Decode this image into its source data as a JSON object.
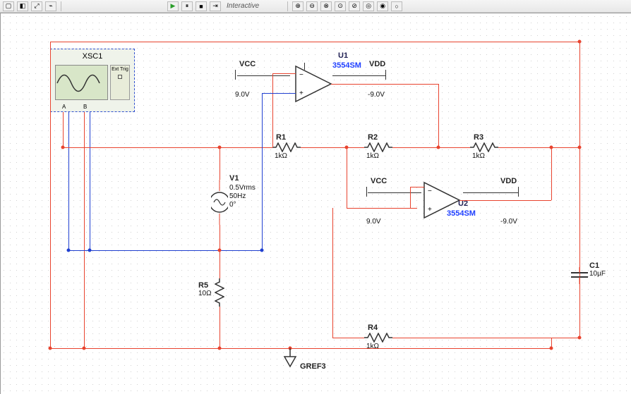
{
  "toolbar": {
    "mode_label": "Interactive"
  },
  "scope": {
    "ref": "XSC1",
    "ext_label": "Ext Trig",
    "chA": "A",
    "chB": "B"
  },
  "components": {
    "U1": {
      "ref": "U1",
      "model": "3554SM",
      "vcc_label": "VCC",
      "vdd_label": "VDD",
      "vcc": "9.0V",
      "vdd": "-9.0V"
    },
    "U2": {
      "ref": "U2",
      "model": "3554SM",
      "vcc_label": "VCC",
      "vdd_label": "VDD",
      "vcc": "9.0V",
      "vdd": "-9.0V"
    },
    "R1": {
      "ref": "R1",
      "value": "1kΩ"
    },
    "R2": {
      "ref": "R2",
      "value": "1kΩ"
    },
    "R3": {
      "ref": "R3",
      "value": "1kΩ"
    },
    "R4": {
      "ref": "R4",
      "value": "1kΩ"
    },
    "R5": {
      "ref": "R5",
      "value": "10Ω"
    },
    "C1": {
      "ref": "C1",
      "value": "10µF"
    },
    "V1": {
      "ref": "V1",
      "value1": "0.5Vrms",
      "value2": "50Hz",
      "value3": "0°"
    },
    "gnd": {
      "ref": "GREF3"
    }
  }
}
